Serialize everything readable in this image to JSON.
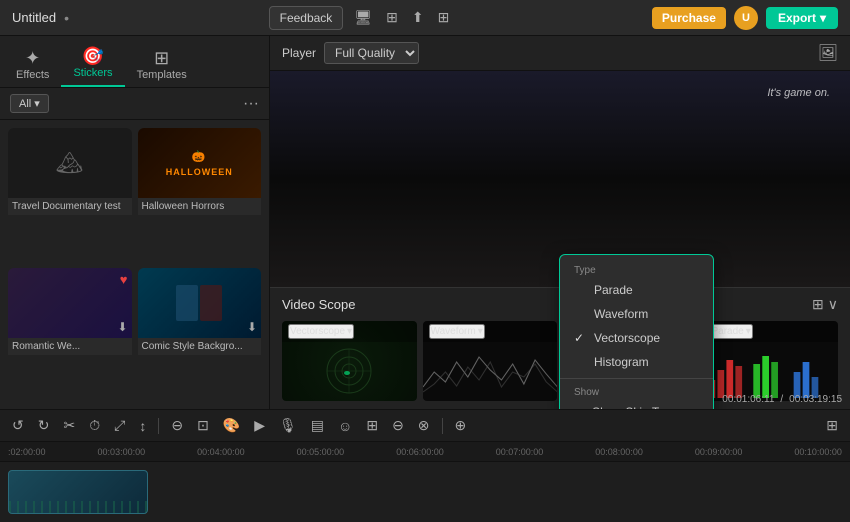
{
  "topbar": {
    "title": "Untitled",
    "feedback_label": "Feedback",
    "purchase_label": "Purchase",
    "export_label": "Export"
  },
  "left_panel": {
    "nav_items": [
      {
        "id": "effects",
        "label": "Effects",
        "icon": "✦"
      },
      {
        "id": "stickers",
        "label": "Stickers",
        "icon": "🎯"
      },
      {
        "id": "templates",
        "label": "Templates",
        "icon": "⊞"
      }
    ],
    "active_nav": "effects",
    "filter_label": "All",
    "media_items": [
      {
        "id": "travel",
        "label": "Travel Documentary test",
        "type": "photo"
      },
      {
        "id": "halloween",
        "label": "Halloween Horrors",
        "type": "halloween"
      },
      {
        "id": "romantic",
        "label": "Romantic We...",
        "type": "romantic"
      },
      {
        "id": "comic",
        "label": "Comic Style Backgro...",
        "type": "comic"
      }
    ]
  },
  "player": {
    "label": "Player",
    "quality": "Full Quality",
    "preview_text": "It's game on."
  },
  "video_scope": {
    "title": "Video Scope",
    "widgets": [
      {
        "id": "vectorscope",
        "label": "Vectorscope",
        "type": "vectorscope"
      },
      {
        "id": "waveform",
        "label": "Waveform",
        "type": "waveform"
      },
      {
        "id": "histogram",
        "label": "Histogram",
        "type": "histogram"
      },
      {
        "id": "parade",
        "label": "Parade",
        "type": "parade"
      }
    ],
    "time_current": "00:01:06:11",
    "time_total": "00:03:19:15"
  },
  "dropdown": {
    "type_section": "Type",
    "items": [
      {
        "label": "Parade",
        "checked": false
      },
      {
        "label": "Waveform",
        "checked": false
      },
      {
        "label": "Vectorscope",
        "checked": true
      },
      {
        "label": "Histogram",
        "checked": false
      }
    ],
    "show_section": "Show",
    "show_items": [
      {
        "label": "Show Skin Tone Indicator",
        "checked": true
      }
    ]
  },
  "timeline": {
    "ruler_marks": [
      "02:00:00",
      "00:03:00:00",
      "00:04:00:00",
      "00:05:00:00",
      "00:06:00:00",
      "00:07:00:00",
      "00:08:00:00",
      "00:09:00:00",
      "00:10:00:00"
    ]
  }
}
